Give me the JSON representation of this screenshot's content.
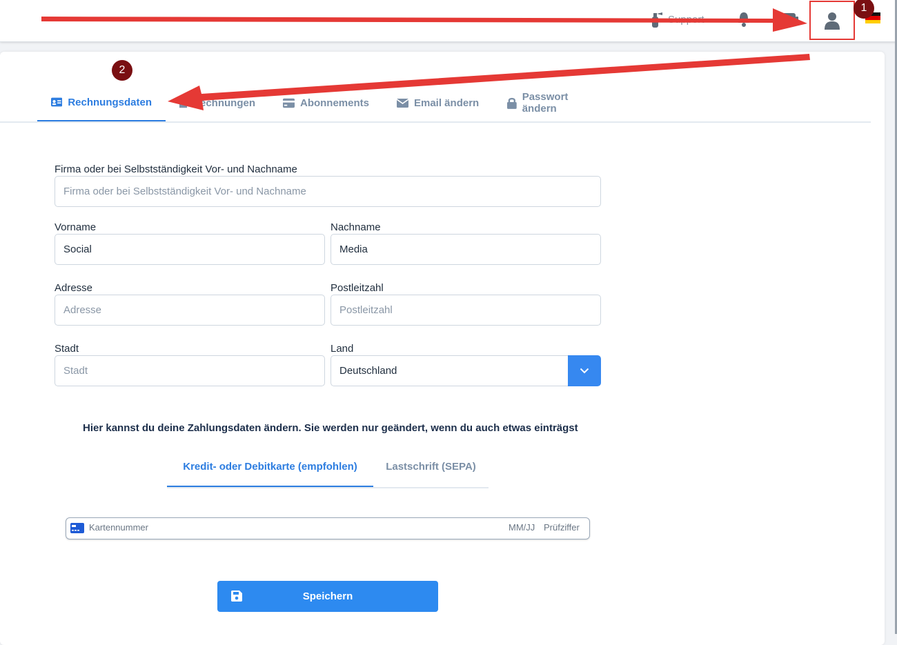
{
  "topbar": {
    "support_label": "Support",
    "support_icon": "fire-extinguisher-icon",
    "bell_icon": "bell-icon",
    "chat_icon": "chat-icon",
    "user_icon": "user-icon",
    "language_flag": "germany-flag-icon"
  },
  "tabs": [
    {
      "label": "Rechnungsdaten",
      "icon": "id-card-icon"
    },
    {
      "label": "Rechnungen",
      "icon": "file-icon"
    },
    {
      "label": "Abonnements",
      "icon": "credit-card-icon"
    },
    {
      "label": "Email ändern",
      "icon": "envelope-icon"
    },
    {
      "label": "Passwort ändern",
      "icon": "lock-icon"
    }
  ],
  "form": {
    "company": {
      "label": "Firma oder bei Selbstständigkeit Vor- und Nachname",
      "placeholder": "Firma oder bei Selbstständigkeit Vor- und Nachname",
      "value": ""
    },
    "firstname": {
      "label": "Vorname",
      "placeholder": "Vorname",
      "value": "Social"
    },
    "lastname": {
      "label": "Nachname",
      "placeholder": "Nachname",
      "value": "Media"
    },
    "address": {
      "label": "Adresse",
      "placeholder": "Adresse",
      "value": ""
    },
    "zip": {
      "label": "Postleitzahl",
      "placeholder": "Postleitzahl",
      "value": ""
    },
    "city": {
      "label": "Stadt",
      "placeholder": "Stadt",
      "value": ""
    },
    "country": {
      "label": "Land",
      "value": "Deutschland"
    }
  },
  "payment": {
    "note": "Hier kannst du deine Zahlungsdaten ändern. Sie werden nur geändert, wenn du auch etwas einträgst",
    "tabs": [
      "Kredit- oder Debitkarte (empfohlen)",
      "Lastschrift (SEPA)"
    ],
    "card_number_placeholder": "Kartennummer",
    "expiry_placeholder": "MM/JJ",
    "cvc_placeholder": "Prüfziffer"
  },
  "save_label": "Speichern",
  "annotations": {
    "badge1": "1",
    "badge2": "2"
  },
  "colors": {
    "accent": "#2d8af0",
    "arrow": "#e53935",
    "badge": "#7a0f12"
  }
}
